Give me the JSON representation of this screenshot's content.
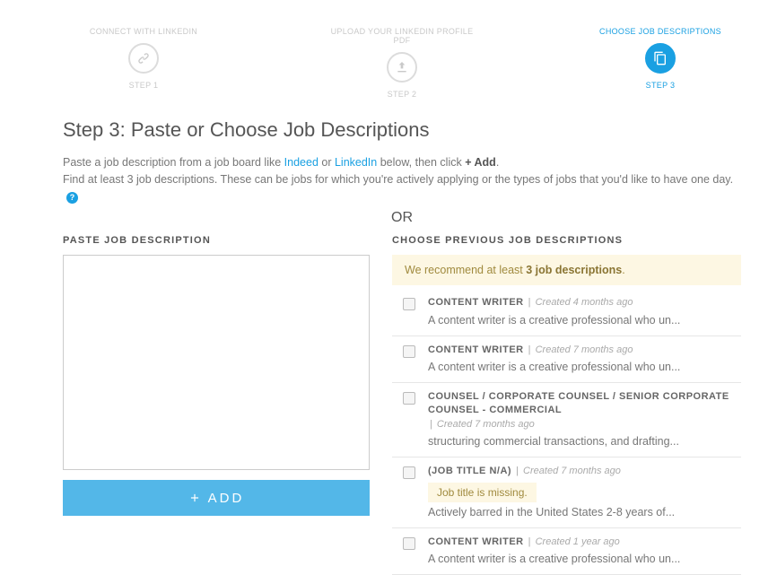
{
  "stepper": {
    "steps": [
      {
        "title": "CONNECT WITH LINKEDIN",
        "sub": "STEP 1",
        "icon": "link"
      },
      {
        "title": "UPLOAD YOUR LINKEDIN PROFILE PDF",
        "sub": "STEP 2",
        "icon": "upload"
      },
      {
        "title": "CHOOSE JOB DESCRIPTIONS",
        "sub": "STEP 3",
        "icon": "copy"
      }
    ],
    "activeIndex": 2
  },
  "heading": "Step 3: Paste or Choose Job Descriptions",
  "instructions": {
    "part1": "Paste a job description from a job board like ",
    "link1": "Indeed",
    "part2": " or ",
    "link2": "LinkedIn",
    "part3": " below, then click ",
    "bold1": "+ Add",
    "part4": ".",
    "line2": "Find at least 3 job descriptions. These can be jobs for which you're actively applying or the types of jobs that you'd like to have one day.",
    "help": "?"
  },
  "orLabel": "OR",
  "left": {
    "heading": "PASTE JOB DESCRIPTION",
    "textareaValue": "",
    "addLabel": "ADD"
  },
  "right": {
    "heading": "CHOOSE PREVIOUS JOB DESCRIPTIONS",
    "reco": {
      "pre": "We recommend at least ",
      "bold": "3 job descriptions",
      "post": "."
    },
    "jobs": [
      {
        "title": "CONTENT WRITER",
        "created": "Created 4 months ago",
        "snippet": "A content writer is a creative professional who un...",
        "warn": ""
      },
      {
        "title": "CONTENT WRITER",
        "created": "Created 7 months ago",
        "snippet": "A content writer is a creative professional who un...",
        "warn": ""
      },
      {
        "title": "COUNSEL / CORPORATE COUNSEL / SENIOR CORPORATE COUNSEL - COMMERCIAL",
        "created": "Created 7 months ago",
        "snippet": "structuring commercial transactions, and drafting...",
        "warn": ""
      },
      {
        "title": "(JOB TITLE N/A)",
        "created": "Created 7 months ago",
        "snippet": "Actively barred in the United States 2-8 years of...",
        "warn": "Job title is missing."
      },
      {
        "title": "CONTENT WRITER",
        "created": "Created 1 year ago",
        "snippet": "A content writer is a creative professional who un...",
        "warn": ""
      }
    ]
  }
}
